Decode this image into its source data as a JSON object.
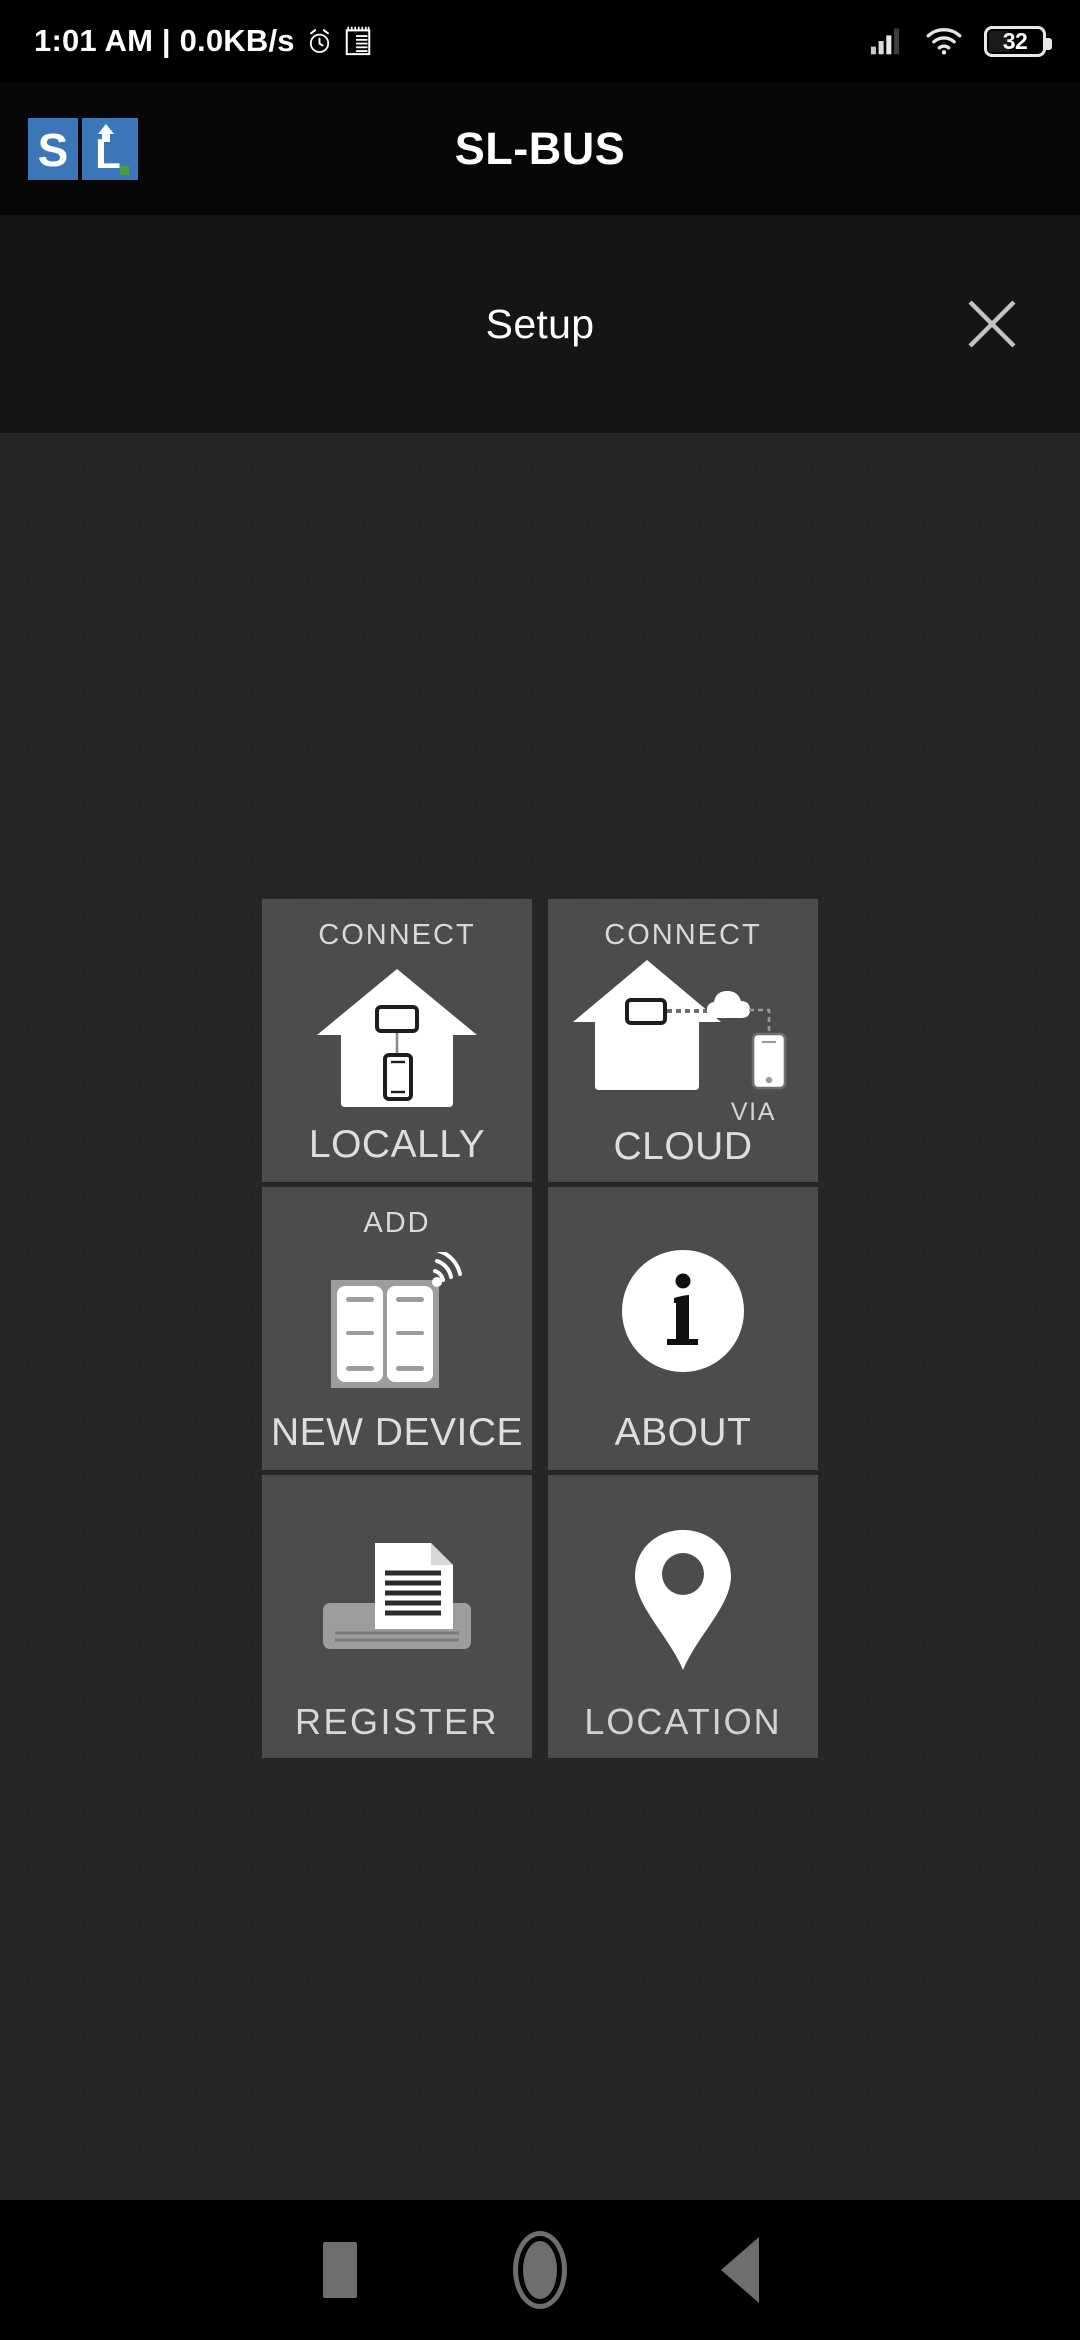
{
  "statusbar": {
    "time_and_speed": "1:01 AM | 0.0KB/s",
    "alarm_icon": "alarm-clock-icon",
    "note_icon": "notepad-icon",
    "signal_icon": "cellular-signal-icon",
    "wifi_icon": "wifi-icon",
    "battery_level": "32",
    "battery_icon": "battery-icon"
  },
  "appbar": {
    "title": "SL-BUS",
    "logo_text_left": "S",
    "logo_text_right": "L",
    "logo_name": "sl-bus-logo",
    "logo_color": "#3a76b8"
  },
  "setup_header": {
    "title": "Setup",
    "close_icon": "close-icon"
  },
  "theme": {
    "background": "#262626",
    "tile_background": "#4c4c4c",
    "appbar_background": "#070707",
    "header_background": "#151515",
    "text_color": "#dedede",
    "icon_color": "#ffffff"
  },
  "grid": {
    "tiles": [
      {
        "id": "connect-locally",
        "top_label": "CONNECT",
        "main_label": "LOCALLY",
        "icon": "house-local-connect-icon"
      },
      {
        "id": "connect-via-cloud",
        "top_label": "CONNECT",
        "small_label": "VIA",
        "main_label": "CLOUD",
        "icon": "house-cloud-connect-icon"
      },
      {
        "id": "add-new-device",
        "top_label": "ADD",
        "main_label": "NEW DEVICE",
        "icon": "wall-switch-wireless-icon"
      },
      {
        "id": "about",
        "top_label": "",
        "main_label": "ABOUT",
        "icon": "info-circle-icon"
      },
      {
        "id": "register",
        "top_label": "",
        "main_label": "REGISTER",
        "icon": "document-tray-icon"
      },
      {
        "id": "location",
        "top_label": "",
        "main_label": "LOCATION",
        "icon": "map-pin-icon"
      }
    ]
  },
  "navbar": {
    "recents_icon": "recents-square-icon",
    "home_icon": "home-circle-icon",
    "back_icon": "back-triangle-icon"
  }
}
